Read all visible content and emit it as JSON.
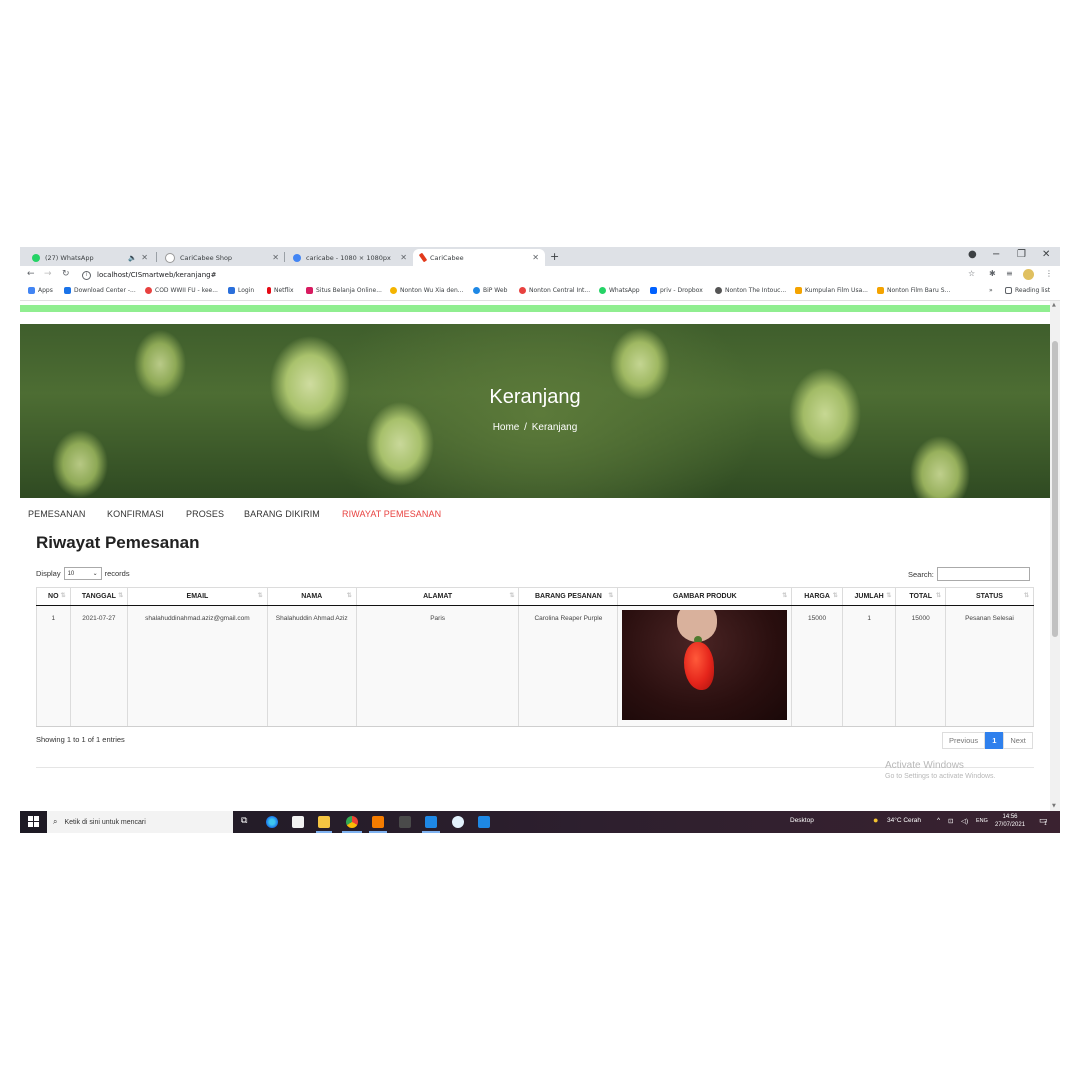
{
  "browser": {
    "tabs": [
      {
        "label": "(27) WhatsApp",
        "active": false,
        "muted": true
      },
      {
        "label": "CariCabee Shop",
        "active": false
      },
      {
        "label": "caricabe - 1080 × 1080px",
        "active": false
      },
      {
        "label": "CariCabee",
        "active": true
      }
    ],
    "new_tab": "+",
    "url": "localhost/CISmartweb/keranjang#",
    "reading_list": "Reading list",
    "bookmarks": [
      "Apps",
      "Download Center -...",
      "COD WWII FU - kee...",
      "Login",
      "Netflix",
      "Situs Belanja Online...",
      "Nonton Wu Xia den...",
      "BiP Web",
      "Nonton Central Int...",
      "WhatsApp",
      "priv - Dropbox",
      "Nonton The Intouc...",
      "Kumpulan Film Usa...",
      "Nonton Film Baru S..."
    ],
    "bookmarks_overflow": "»"
  },
  "hero": {
    "title": "Keranjang",
    "breadcrumb_home": "Home",
    "breadcrumb_sep": "/",
    "breadcrumb_current": "Keranjang"
  },
  "order_tabs": [
    {
      "label": "PEMESANAN",
      "active": false
    },
    {
      "label": "KONFIRMASI",
      "active": false
    },
    {
      "label": "PROSES",
      "active": false
    },
    {
      "label": "BARANG DIKIRIM",
      "active": false
    },
    {
      "label": "RIWAYAT PEMESANAN",
      "active": true
    }
  ],
  "heading": "Riwayat Pemesanan",
  "length_control": {
    "prefix": "Display",
    "value": "10",
    "suffix": "records"
  },
  "search_label": "Search:",
  "table": {
    "headers": [
      "NO",
      "TANGGAL",
      "EMAIL",
      "NAMA",
      "ALAMAT",
      "BARANG PESANAN",
      "GAMBAR PRODUK",
      "HARGA",
      "JUMLAH",
      "TOTAL",
      "STATUS"
    ],
    "rows": [
      {
        "no": "1",
        "tanggal": "2021-07-27",
        "email": "shalahuddinahmad.aziz@gmail.com",
        "nama": "Shalahuddin Ahmad Aziz",
        "alamat": "Paris",
        "barang": "Carolina Reaper Purple",
        "harga": "15000",
        "jumlah": "1",
        "total": "15000",
        "status": "Pesanan Selesai"
      }
    ]
  },
  "table_info": "Showing 1 to 1 of 1 entries",
  "pagination": {
    "previous": "Previous",
    "current": "1",
    "next": "Next"
  },
  "activate_windows": {
    "title": "Activate Windows",
    "subtitle": "Go to Settings to activate Windows."
  },
  "taskbar": {
    "search_placeholder": "Ketik di sini untuk mencari",
    "desktop_label": "Desktop",
    "weather": "34°C  Cerah",
    "language": "ENG",
    "time": "14:56",
    "date": "27/07/2021",
    "notification_count": "1"
  },
  "colors": {
    "accent_green": "#90ee90",
    "active_tab_red": "#e8413f",
    "pager_blue": "#2f80ed"
  }
}
